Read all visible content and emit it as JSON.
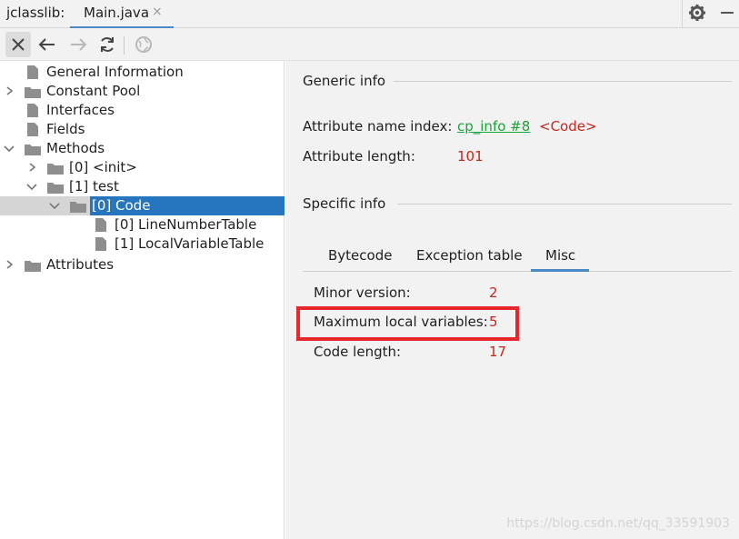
{
  "titlebar": {
    "app_label": "jclasslib:",
    "tab_label": "Main.java",
    "tab_close": "×"
  },
  "toolbar": {
    "close": "close-icon",
    "back": "arrow-left-icon",
    "forward": "arrow-right-icon",
    "refresh": "refresh-icon",
    "web": "globe-icon"
  },
  "tree": {
    "items": [
      {
        "label": "General Information"
      },
      {
        "label": "Constant Pool"
      },
      {
        "label": "Interfaces"
      },
      {
        "label": "Fields"
      },
      {
        "label": "Methods"
      },
      {
        "label": "[0] <init>"
      },
      {
        "label": "[1] test"
      },
      {
        "label": "[0] Code"
      },
      {
        "label": "[0] LineNumberTable"
      },
      {
        "label": "[1] LocalVariableTable"
      },
      {
        "label": "Attributes"
      }
    ]
  },
  "generic": {
    "title": "Generic info",
    "name_index_key": "Attribute name index:",
    "name_index_link": "cp_info #8",
    "name_index_value": "<Code>",
    "length_key": "Attribute length:",
    "length_value": "101"
  },
  "specific": {
    "title": "Specific info",
    "tabs": [
      "Bytecode",
      "Exception table",
      "Misc"
    ],
    "active_tab": "Misc",
    "minor_key": "Minor version:",
    "minor_value": "2",
    "maxlocals_key": "Maximum local variables:",
    "maxlocals_value": "5",
    "codelen_key": "Code length:",
    "codelen_value": "17"
  },
  "watermark": "https://blog.csdn.net/qq_33591903",
  "colors": {
    "accent": "#4a88c7",
    "selection": "#2675bf",
    "value_red": "#c6271b",
    "link_green": "#19a43a",
    "highlight_red": "#e8262b"
  }
}
